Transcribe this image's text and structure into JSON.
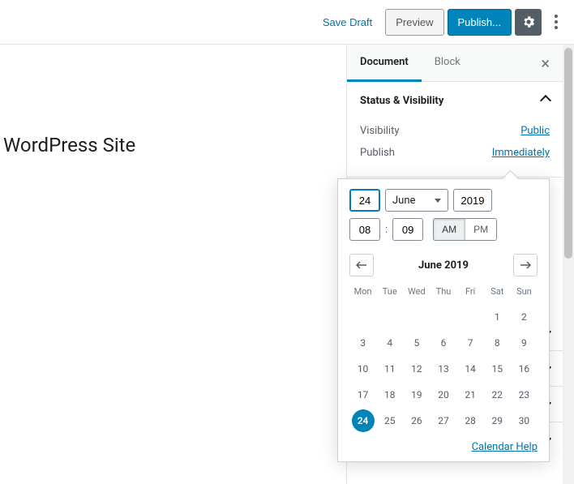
{
  "toolbar": {
    "save_draft": "Save Draft",
    "preview": "Preview",
    "publish": "Publish..."
  },
  "canvas": {
    "title": "WordPress Site"
  },
  "tabs": {
    "document": "Document",
    "block": "Block"
  },
  "status_panel": {
    "title": "Status & Visibility",
    "visibility_label": "Visibility",
    "visibility_value": "Public",
    "publish_label": "Publish",
    "publish_value": "Immediately"
  },
  "datepicker": {
    "day": "24",
    "month": "June",
    "year": "2019",
    "hour": "08",
    "minute": "09",
    "am": "AM",
    "pm": "PM",
    "month_title": "June 2019",
    "dow": [
      "Mon",
      "Tue",
      "Wed",
      "Thu",
      "Fri",
      "Sat",
      "Sun"
    ],
    "weeks": [
      [
        "",
        "",
        "",
        "",
        "",
        "1",
        "2"
      ],
      [
        "3",
        "4",
        "5",
        "6",
        "7",
        "8",
        "9"
      ],
      [
        "10",
        "11",
        "12",
        "13",
        "14",
        "15",
        "16"
      ],
      [
        "17",
        "18",
        "19",
        "20",
        "21",
        "22",
        "23"
      ],
      [
        "24",
        "25",
        "26",
        "27",
        "28",
        "29",
        "30"
      ]
    ],
    "selected": "24",
    "help": "Calendar Help"
  }
}
